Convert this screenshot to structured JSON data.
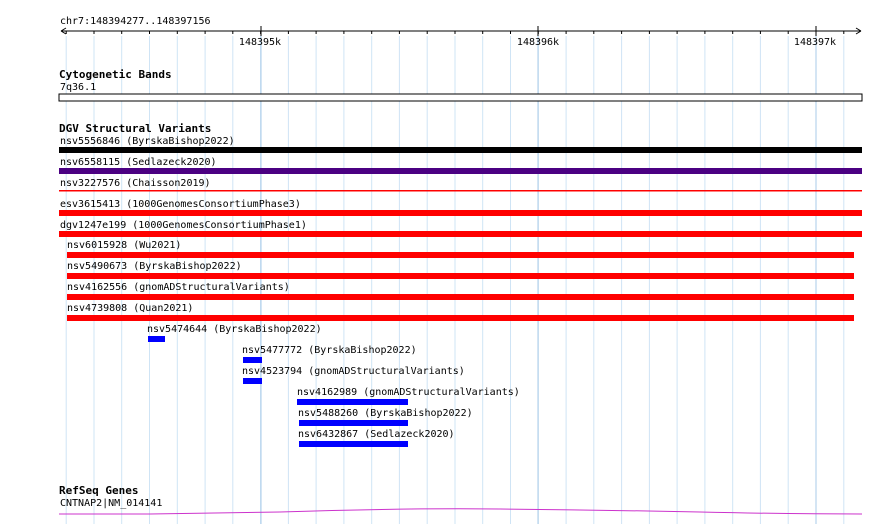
{
  "coordinates": "chr7:148394277..148397156",
  "ruler": {
    "ticks": [
      "148395k",
      "148396k",
      "148397k"
    ]
  },
  "tracks": {
    "cytoband": {
      "title": "Cytogenetic Bands",
      "band": "7q36.1"
    },
    "dgv": {
      "title": "DGV Structural Variants",
      "features": [
        {
          "id": "nsv5556846",
          "source": "(ByrskaBishop2022)",
          "color": "#000000"
        },
        {
          "id": "nsv6558115",
          "source": "(Sedlazeck2020)",
          "color": "#4b0082"
        },
        {
          "id": "nsv3227576",
          "source": "(Chaisson2019)",
          "color": "#ff0000"
        },
        {
          "id": "esv3615413",
          "source": "(1000GenomesConsortiumPhase3)",
          "color": "#ff0000"
        },
        {
          "id": "dgv1247e199",
          "source": "(1000GenomesConsortiumPhase1)",
          "color": "#ff0000"
        },
        {
          "id": "nsv6015928",
          "source": "(Wu2021)",
          "color": "#ff0000"
        },
        {
          "id": "nsv5490673",
          "source": "(ByrskaBishop2022)",
          "color": "#ff0000"
        },
        {
          "id": "nsv4162556",
          "source": "(gnomADStructuralVariants)",
          "color": "#ff0000"
        },
        {
          "id": "nsv4739808",
          "source": "(Quan2021)",
          "color": "#ff0000"
        },
        {
          "id": "nsv5474644",
          "source": "(ByrskaBishop2022)",
          "color": "#0000ff"
        },
        {
          "id": "nsv5477772",
          "source": "(ByrskaBishop2022)",
          "color": "#0000ff"
        },
        {
          "id": "nsv4523794",
          "source": "(gnomADStructuralVariants)",
          "color": "#0000ff"
        },
        {
          "id": "nsv4162989",
          "source": "(gnomADStructuralVariants)",
          "color": "#0000ff"
        },
        {
          "id": "nsv5488260",
          "source": "(ByrskaBishop2022)",
          "color": "#0000ff"
        },
        {
          "id": "nsv6432867",
          "source": "(Sedlazeck2020)",
          "color": "#0000ff"
        }
      ]
    },
    "refseq": {
      "title": "RefSeq Genes",
      "gene": "CNTNAP2|NM_014141",
      "color": "#cc33cc"
    }
  }
}
